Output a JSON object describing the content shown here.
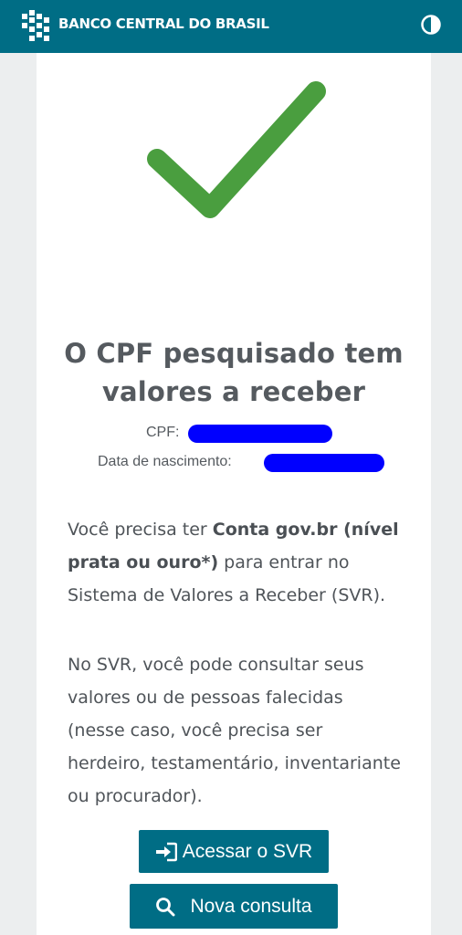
{
  "header": {
    "brand": "BANCO CENTRAL DO BRASIL",
    "contrast_icon": "contrast-icon",
    "color": "#006d85"
  },
  "result": {
    "status_icon": "checkmark-icon",
    "status_color": "#4a9e3f",
    "title_line1": "O CPF pesquisado tem",
    "title_line2": "valores a receber",
    "cpf_label": "CPF:",
    "birth_label": "Data de nascimento:"
  },
  "info": {
    "p1_pre": "Você precisa ter ",
    "p1_bold": "Conta gov.br (nível prata ou ouro*)",
    "p1_post": " para entrar no Sistema de Valores a Receber (SVR).",
    "p2": "No SVR, você pode consultar seus valores ou de pessoas falecidas (nesse caso, você precisa ser herdeiro, testamentário, inventariante ou procurador)."
  },
  "actions": {
    "access_label": "Acessar o SVR",
    "new_query_label": "Nova consulta"
  }
}
